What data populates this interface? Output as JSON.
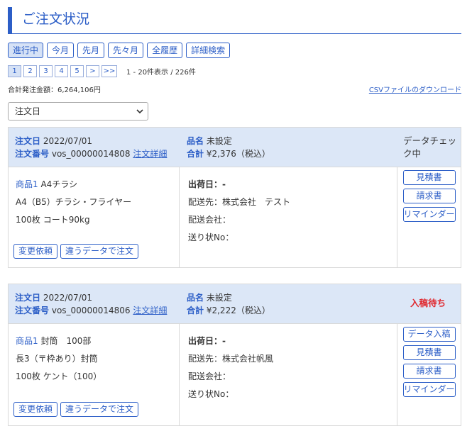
{
  "page": {
    "title": "ご注文状況"
  },
  "filters": [
    {
      "label": "進行中",
      "active": true
    },
    {
      "label": "今月"
    },
    {
      "label": "先月"
    },
    {
      "label": "先々月"
    },
    {
      "label": "全履歴"
    },
    {
      "label": "詳細検索"
    }
  ],
  "pager": {
    "pages": [
      "1",
      "2",
      "3",
      "4",
      "5"
    ],
    "next": ">",
    "last": ">>",
    "info": "1 - 20件表示 / 226件"
  },
  "summary": {
    "total": "合計発注金額：6,264,106円",
    "csv_link": "CSVファイルのダウンロード"
  },
  "sort": {
    "value": "注文日"
  },
  "labels": {
    "order_date": "注文日",
    "order_number": "注文番号",
    "order_detail": "注文詳細",
    "item_name": "品名",
    "total": "合計",
    "item": "商品1",
    "ship_date": "出荷日：-",
    "destination": "配送先：",
    "carrier": "配送会社：",
    "tracking": "送り状No：",
    "change_request": "変更依頼",
    "reorder": "違うデータで注文"
  },
  "orders": [
    {
      "date": "2022/07/01",
      "number": "vos_00000014808",
      "item_name": "未設定",
      "total": "¥2,376（税込）",
      "status": "データチェック中",
      "product": "A4チラシ",
      "spec1": "A4（B5）チラシ・フライヤー",
      "spec2": "100枚 コート90kg",
      "destination": "株式会社　テスト",
      "actions": [
        "見積書",
        "請求書",
        "リマインダー"
      ]
    },
    {
      "date": "2022/07/01",
      "number": "vos_00000014806",
      "item_name": "未設定",
      "total": "¥2,222（税込）",
      "status": "入稿待ち",
      "product": "封筒　100部",
      "spec1": "長3（〒枠あり）封筒",
      "spec2": "100枚 ケント（100）",
      "destination": "株式会社帆風",
      "actions": [
        "データ入稿",
        "見積書",
        "請求書",
        "リマインダー"
      ]
    }
  ],
  "colors": {
    "accent": "#2c5ec7",
    "header_bg": "#dce7f7",
    "status_red": "#e0282e"
  }
}
